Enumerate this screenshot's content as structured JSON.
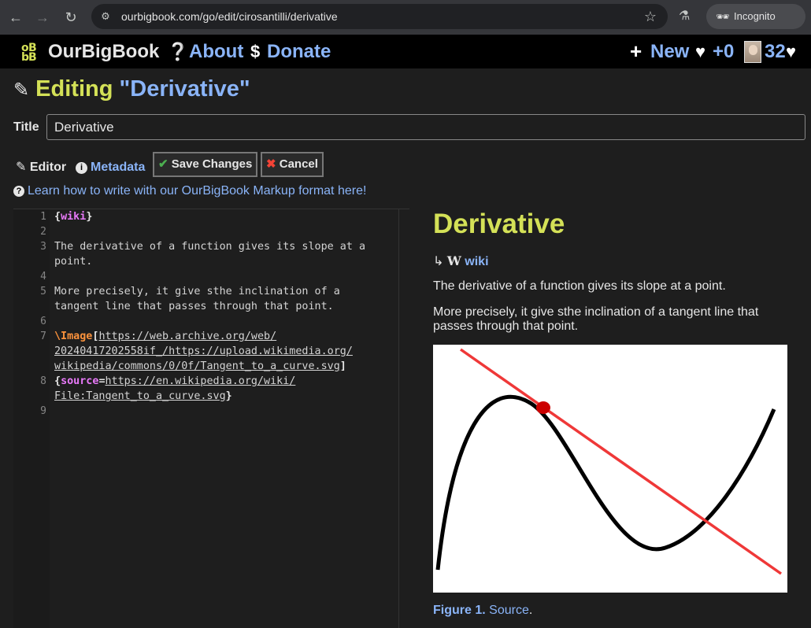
{
  "browser": {
    "url": "ourbigbook.com/go/edit/cirosantilli/derivative",
    "incognito_label": "Incognito"
  },
  "nav": {
    "brand": "OurBigBook",
    "about": "About",
    "donate": "Donate",
    "new": "New",
    "likes": "+0",
    "user_score": "32"
  },
  "page": {
    "editing_word": "Editing",
    "editing_name": "\"Derivative\"",
    "title_label": "Title",
    "title_value": "Derivative",
    "tab_editor": "Editor",
    "tab_metadata": "Metadata",
    "save_button": "Save Changes",
    "cancel_button": "Cancel",
    "learn_link": "Learn how to write with our OurBigBook Markup format here!"
  },
  "editor": {
    "line_numbers": [
      "1",
      "2",
      "3",
      "4",
      "5",
      "6",
      "7",
      "8",
      "9"
    ],
    "line1_kw": "wiki",
    "line3a": "The derivative of a function gives its slope at a",
    "line3b": "point.",
    "line5a": "More precisely, it give sthe inclination of a",
    "line5b": "tangent line that passes through that point.",
    "line7_macro": "\\Image",
    "line7_url_a": "https://web.archive.org/web/",
    "line7_url_b": "20240417202558if_/https://upload.wikimedia.org/",
    "line7_url_c": "wikipedia/commons/0/0f/Tangent_to_a_curve.svg",
    "line8_kw": "source",
    "line8_url_a": "https://en.wikipedia.org/wiki/",
    "line8_url_b": "File:Tangent_to_a_curve.svg"
  },
  "preview": {
    "heading": "Derivative",
    "wiki_link": "wiki",
    "p1": "The derivative of a function gives its slope at a point.",
    "p2": "More precisely, it give sthe inclination of a tangent line that passes through that point.",
    "figure_label": "Figure 1.",
    "figure_source": "Source",
    "colors": {
      "curve": "#000000",
      "tangent": "#ef3838",
      "point": "#cc0000"
    }
  }
}
